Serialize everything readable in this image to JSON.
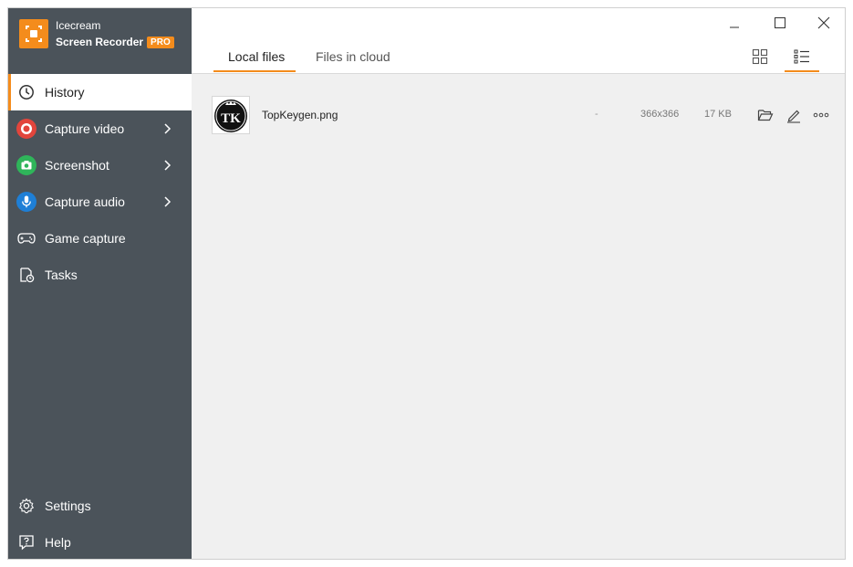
{
  "app": {
    "name_line1": "Icecream",
    "name_line2": "Screen Recorder",
    "badge": "PRO",
    "accent_color": "#f48c1c",
    "sidebar_color": "#4b535a"
  },
  "sidebar": {
    "items": [
      {
        "label": "History",
        "icon": "clock-icon",
        "active": true
      },
      {
        "label": "Capture video",
        "icon": "record-icon",
        "color": "#e2453c"
      },
      {
        "label": "Screenshot",
        "icon": "camera-icon",
        "color": "#2fb55a"
      },
      {
        "label": "Capture audio",
        "icon": "microphone-icon",
        "color": "#1e7fd6"
      },
      {
        "label": "Game capture",
        "icon": "gamepad-icon"
      },
      {
        "label": "Tasks",
        "icon": "tasks-icon"
      }
    ],
    "bottom_items": [
      {
        "label": "Settings",
        "icon": "gear-icon"
      },
      {
        "label": "Help",
        "icon": "help-icon"
      }
    ]
  },
  "tabs": [
    {
      "label": "Local files",
      "active": true
    },
    {
      "label": "Files in cloud",
      "active": false
    }
  ],
  "view_modes": [
    "grid-view-icon",
    "list-view-icon"
  ],
  "files": [
    {
      "name": "TopKeygen.png",
      "dash": "-",
      "dimensions": "366x366",
      "size": "17 KB",
      "thumbnail_text": "TK"
    }
  ]
}
